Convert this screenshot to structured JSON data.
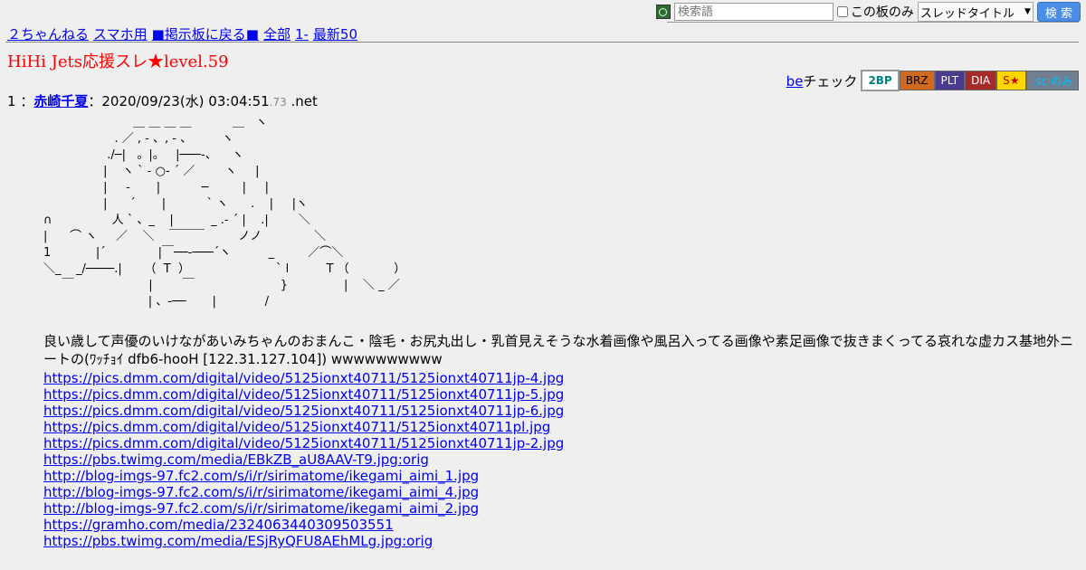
{
  "search": {
    "placeholder": "検索語",
    "board_only_label": "この板のみ",
    "scope_value": "スレッドタイトル",
    "button_label": "検 索"
  },
  "nav": {
    "items": [
      "２ちゃんねる",
      "スマホ用",
      "■掲示板に戻る■",
      "全部",
      "1-",
      "最新50"
    ]
  },
  "thread": {
    "title": "HiHi Jets応援スレ★level.59"
  },
  "becheck": {
    "be_link": "be",
    "label": "チェック",
    "tags": [
      "2BP",
      "BRZ",
      "PLT",
      "DIA",
      "S★",
      ".sc のみ"
    ]
  },
  "post": {
    "number": "1",
    "sep1": "：",
    "name": "赤崎千夏",
    "sep2": "：",
    "date": "2020/09/23(水) 03:04:51",
    "ms": ".73",
    "suffix": " .net",
    "aa": "                        ＿ ＿ ＿ ＿           ＿   ヽ\n                   . ／ , - 、, - 、        ヽ\n                 ./─|   。|。   |───-、    ヽ\n                |    ヽ ` - ○- ´ ／        ヽ     |\n                |     -       |           ─         |     |\n                |      ´       |           ` ヽ      .    |     |ヽ\n∩                人 ` 、_    |          _ .- ´ |    .|        ＼\n|      ⌒ ヽ     ／    ＼    ￣￣￣         ノノ              ＼\n1            |´              |￣──-───´ヽ          _         ／⌒＼\n＼_    _/────.|      （  T  ）                       ` l          T （            ）\n     ￣                    |        ￣                       }               |    ＼ _ ／\n                            | 、-──       |             /",
    "body": "良い歳して声優のいけながあいみちゃんのおまんこ・陰毛・お尻丸出し・乳首見えそうな水着画像や風呂入ってる画像や素足画像で抜きまくってる哀れな虚カス基地外ニートの(ﾜｯﾁｮｲ dfb6-hooH [122.31.127.104]) wwwwwwwwww",
    "links": [
      "https://pics.dmm.com/digital/video/5125ionxt40711/5125ionxt40711jp-4.jpg",
      "https://pics.dmm.com/digital/video/5125ionxt40711/5125ionxt40711jp-5.jpg",
      "https://pics.dmm.com/digital/video/5125ionxt40711/5125ionxt40711jp-6.jpg",
      "https://pics.dmm.com/digital/video/5125ionxt40711/5125ionxt40711pl.jpg",
      "https://pics.dmm.com/digital/video/5125ionxt40711/5125ionxt40711jp-2.jpg",
      "https://pbs.twimg.com/media/EBkZB_aU8AAV-T9.jpg:orig",
      "http://blog-imgs-97.fc2.com/s/i/r/sirimatome/ikegami_aimi_1.jpg",
      "http://blog-imgs-97.fc2.com/s/i/r/sirimatome/ikegami_aimi_4.jpg",
      "http://blog-imgs-97.fc2.com/s/i/r/sirimatome/ikegami_aimi_2.jpg",
      "https://gramho.com/media/2324063440309503551",
      "https://pbs.twimg.com/media/ESjRyQFU8AEhMLg.jpg:orig"
    ]
  },
  "colors": {
    "background": "#efefef",
    "title": "#ff0000",
    "link": "#0000ee",
    "search_button": "#4a8ee6"
  }
}
